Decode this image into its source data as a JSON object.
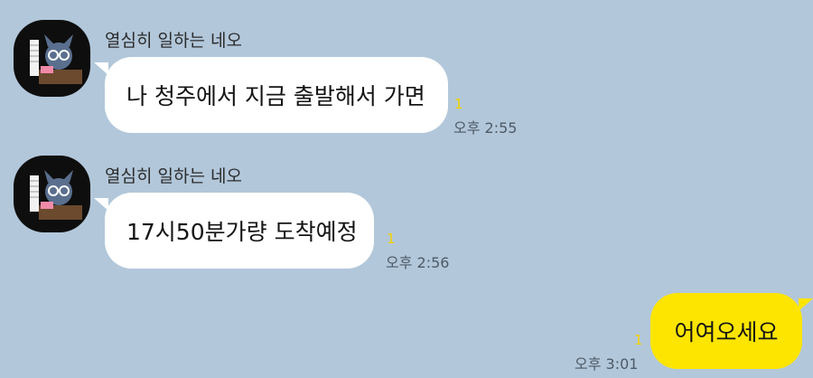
{
  "messages": [
    {
      "sender": "열심히 일하는 네오",
      "text": "나 청주에서 지금 출발해서 가면",
      "unread": "1",
      "time": "오후 2:55"
    },
    {
      "sender": "열심히 일하는 네오",
      "text": "17시50분가량 도착예정",
      "unread": "1",
      "time": "오후 2:56"
    },
    {
      "text": "어여오세요",
      "unread": "1",
      "time": "오후 3:01"
    }
  ],
  "colors": {
    "background": "#b2c7da",
    "incoming_bubble": "#ffffff",
    "outgoing_bubble": "#fee500",
    "unread": "#f5d400"
  },
  "icons": {
    "avatar": "neo-working-at-laptop-avatar"
  }
}
